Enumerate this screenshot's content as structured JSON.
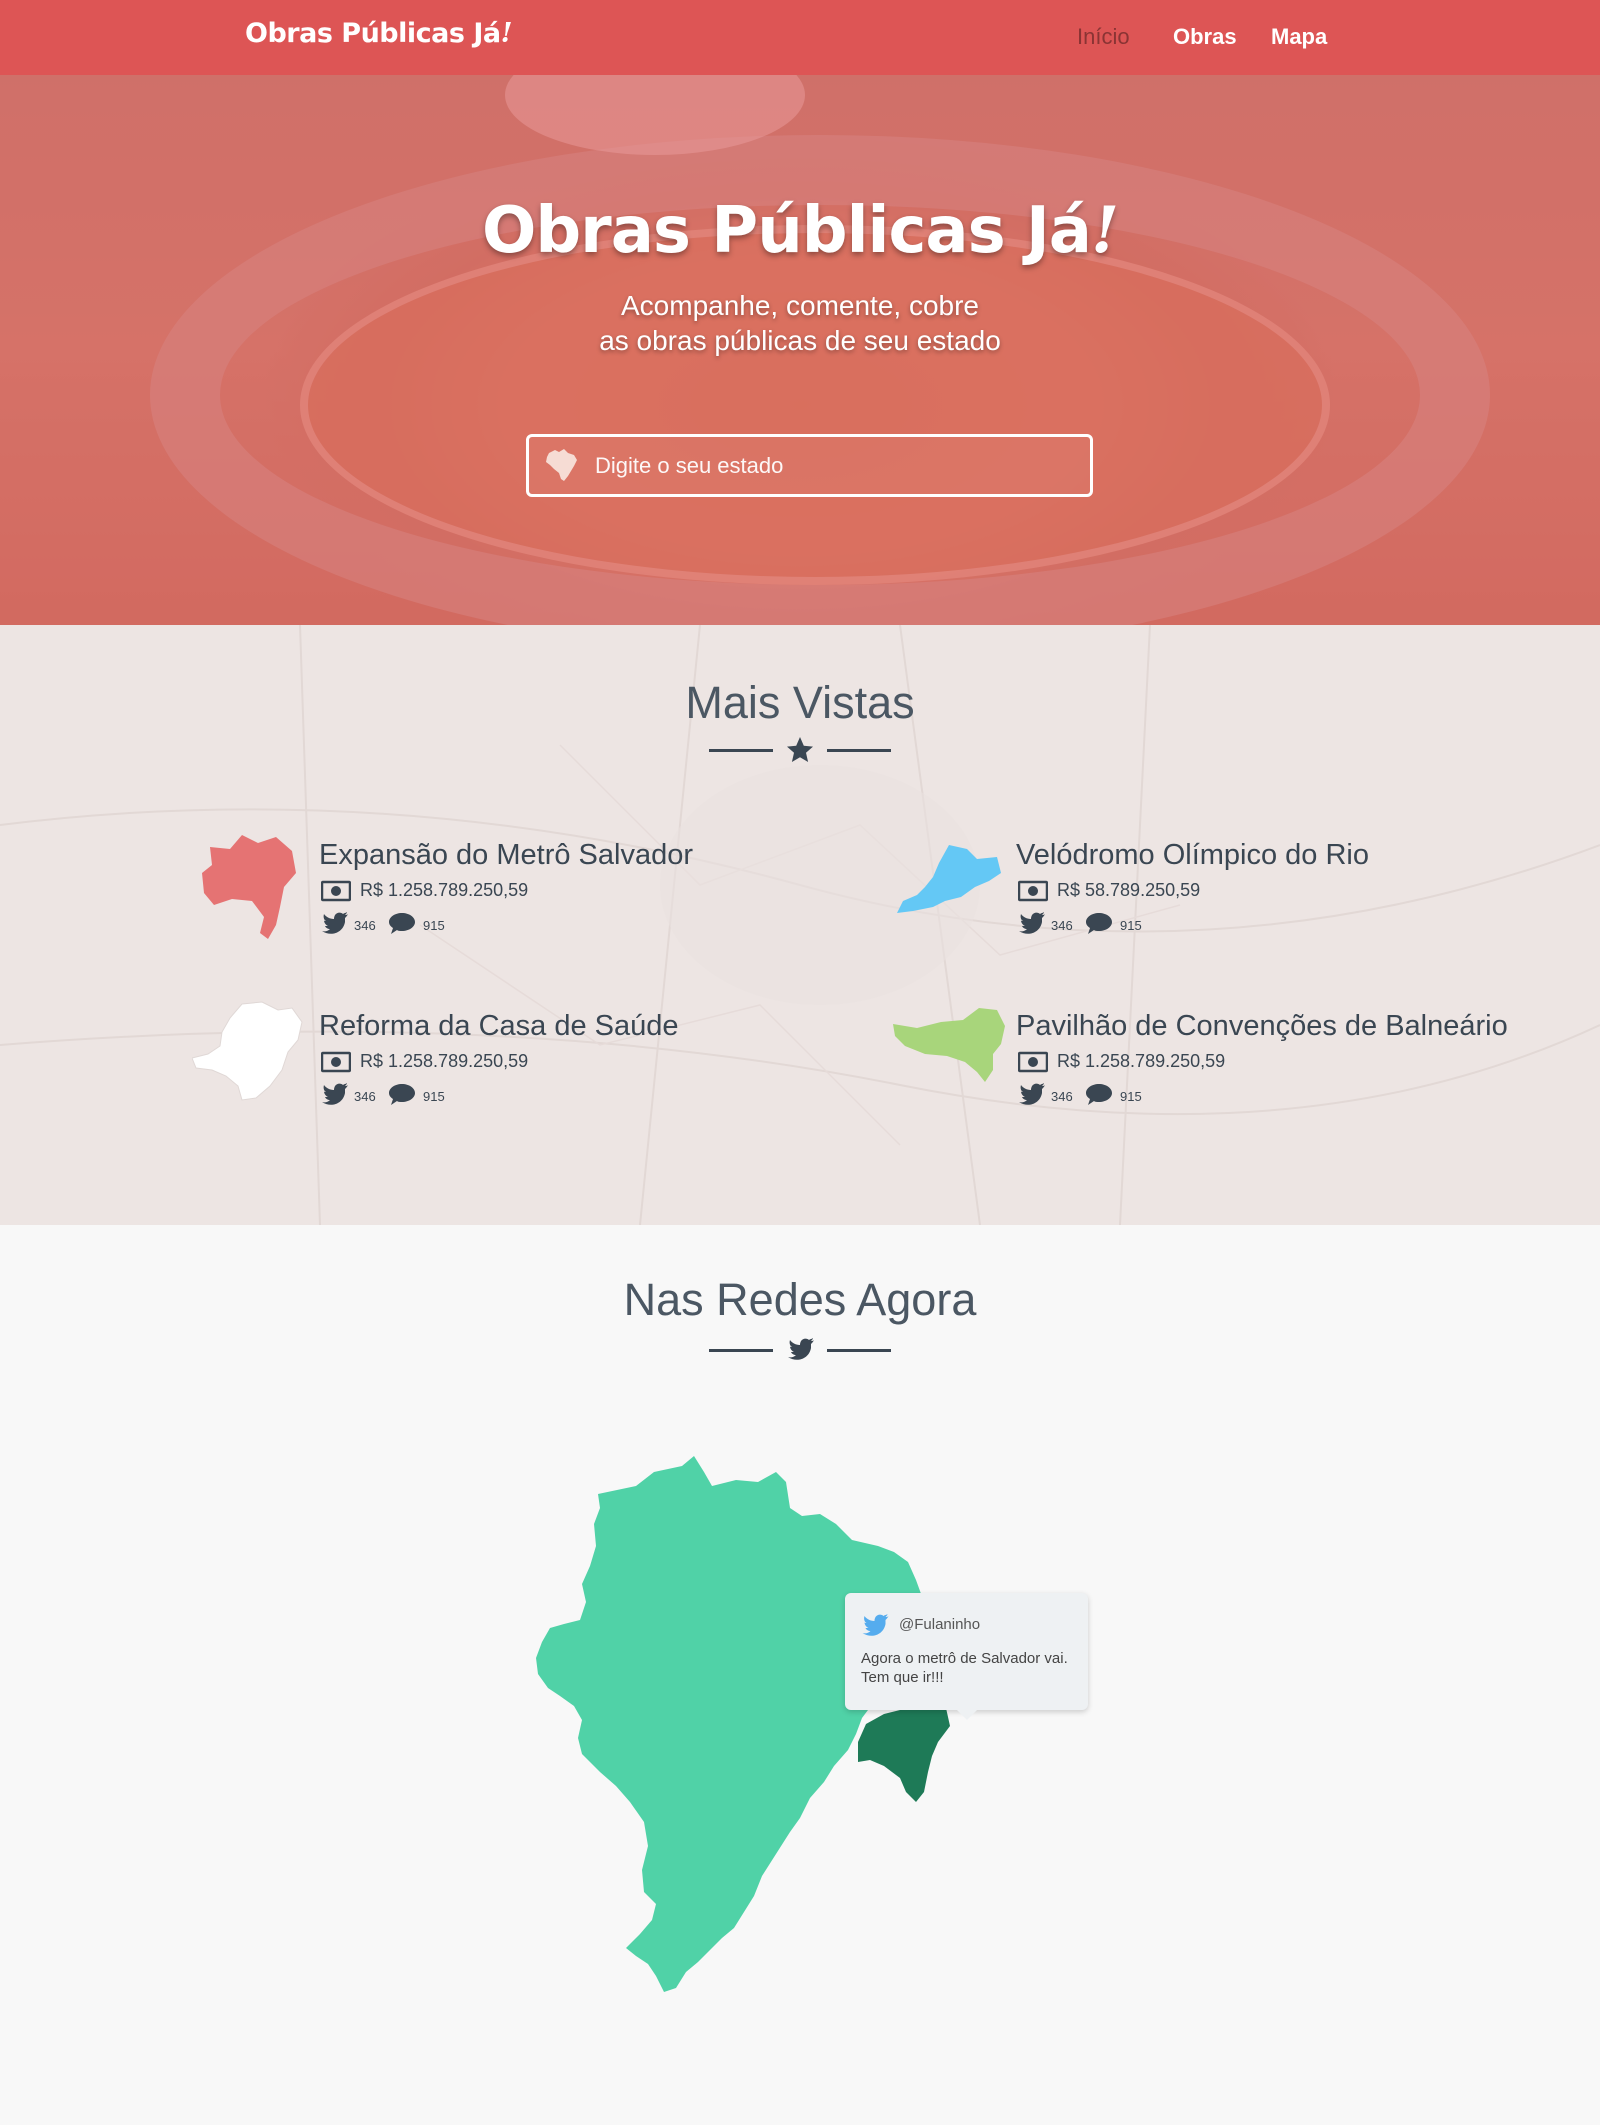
{
  "navbar": {
    "brand": "Obras Públicas Já",
    "brand_excl": "!",
    "links": [
      {
        "label": "Início",
        "active": true
      },
      {
        "label": "Obras",
        "active": false
      },
      {
        "label": "Mapa",
        "active": false
      }
    ]
  },
  "hero": {
    "title": "Obras Públicas Já",
    "title_excl": "!",
    "subtitle_line1": "Acompanhe, comente, cobre",
    "subtitle_line2": "as obras públicas de seu estado",
    "search_placeholder": "Digite o seu estado",
    "search_icon": "brazil-map-icon"
  },
  "mais_vistas": {
    "title": "Mais Vistas",
    "divider_icon": "star-icon",
    "works": [
      {
        "title": "Expansão do Metrô Salvador",
        "value": "R$ 1.258.789.250,59",
        "tweets": "346",
        "comments": "915",
        "state_icon": "bahia-state-icon",
        "color": "#e57373"
      },
      {
        "title": "Velódromo Olímpico do Rio",
        "value": "R$ 58.789.250,59",
        "tweets": "346",
        "comments": "915",
        "state_icon": "rio-de-janeiro-state-icon",
        "color": "#64c8f5"
      },
      {
        "title": "Reforma da Casa de Saúde",
        "value": "R$ 1.258.789.250,59",
        "tweets": "346",
        "comments": "915",
        "state_icon": "minas-gerais-state-icon",
        "color": "#ffffff"
      },
      {
        "title": "Pavilhão de Convenções de Balneário",
        "value": "R$ 1.258.789.250,59",
        "tweets": "346",
        "comments": "915",
        "state_icon": "santa-catarina-state-icon",
        "color": "#a8d57b"
      }
    ]
  },
  "nas_redes": {
    "title": "Nas Redes Agora",
    "divider_icon": "twitter-bird-icon",
    "map_color": "#50d2a7",
    "highlight_color": "#1e7a57",
    "tweet": {
      "user": "@Fulaninho",
      "text": "Agora o metrô de Salvador vai. Tem que ir!!!"
    }
  }
}
